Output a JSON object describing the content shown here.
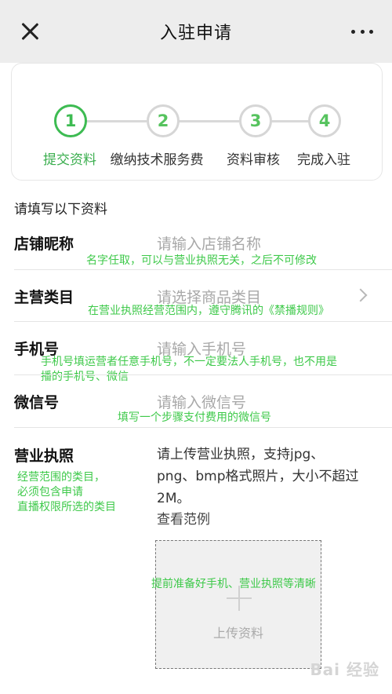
{
  "header": {
    "title": "入驻申请",
    "close_icon": "close-icon",
    "more_icon": "more-icon"
  },
  "steps": [
    {
      "number": "1",
      "label": "提交资料",
      "active": true
    },
    {
      "number": "2",
      "label": "缴纳技术服务费",
      "active": false
    },
    {
      "number": "3",
      "label": "资料审核",
      "active": false
    },
    {
      "number": "4",
      "label": "完成入驻",
      "active": false
    }
  ],
  "section_title": "请填写以下资料",
  "fields": {
    "store_name": {
      "label": "店铺昵称",
      "placeholder": "请输入店铺名称",
      "note": "名字任取，可以与营业执照无关，之后不可修改"
    },
    "category": {
      "label": "主营类目",
      "placeholder": "请选择商品类目",
      "note": "在营业执照经营范围内，遵守腾讯的《禁播规则》"
    },
    "phone": {
      "label": "手机号",
      "placeholder": "请输入手机号",
      "note_line1": "手机号填运营者任意手机号，不一定要法人手机号，也不用是",
      "note_line2": "播的手机号、微信"
    },
    "wechat": {
      "label": "微信号",
      "placeholder": "请输入微信号",
      "note": "填写一个步骤支付费用的微信号"
    },
    "license": {
      "label": "营业执照",
      "desc": "请上传营业执照，支持jpg、png、bmp格式照片，大小不超过2M。",
      "example_link": "查看范例",
      "note_lines": [
        "经营范围的类目，",
        "必须包含申请",
        "直播权限所选的类目"
      ],
      "upload_text": "上传资料",
      "upload_note": "提前准备好手机、营业执照等清晰"
    }
  },
  "watermark": "Bai 经验",
  "colors": {
    "accent": "#3dbb52",
    "annotation": "#3ec94a",
    "placeholder": "#a8a8a8"
  }
}
